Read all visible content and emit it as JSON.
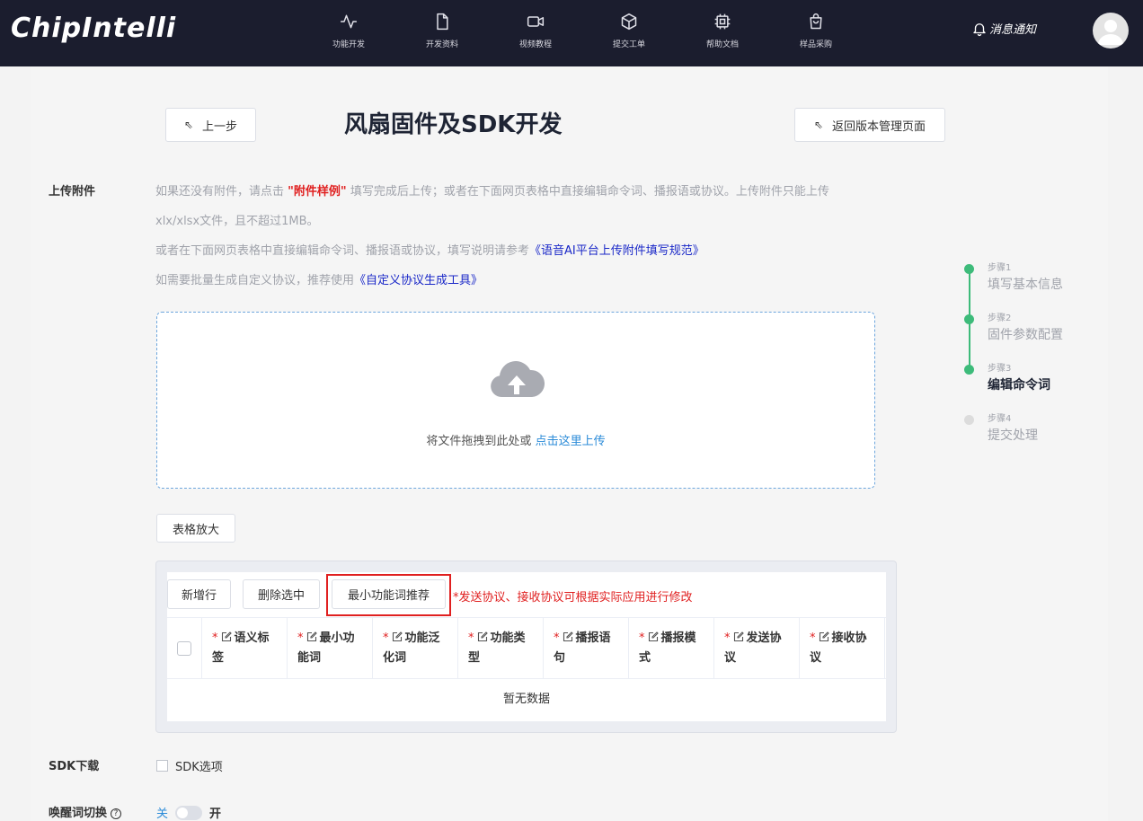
{
  "header": {
    "logo": "ChipIntelli",
    "nav": [
      {
        "label": "功能开发",
        "icon": "activity-icon"
      },
      {
        "label": "开发资料",
        "icon": "file-icon"
      },
      {
        "label": "视频教程",
        "icon": "video-icon"
      },
      {
        "label": "提交工单",
        "icon": "box-icon"
      },
      {
        "label": "帮助文档",
        "icon": "chip-icon"
      },
      {
        "label": "样品采购",
        "icon": "shopping-bag-icon"
      }
    ],
    "notify_label": "消息通知"
  },
  "toolbar": {
    "prev_label": "上一步",
    "back_label": "返回版本管理页面",
    "title": "风扇固件及SDK开发"
  },
  "upload_section": {
    "label": "上传附件",
    "line1_a": "如果还没有附件，请点击",
    "line1_link": "\"附件样例\"",
    "line1_b": "填写完成后上传；或者在下面网页表格中直接编辑命令词、播报语或协议。上传附件只能上传",
    "line2": "xlx/xlsx文件，且不超过1MB。",
    "line3_a": "或者在下面网页表格中直接编辑命令词、播报语或协议，填写说明请参考",
    "line3_link": "《语音AI平台上传附件填写规范》",
    "line4_a": "如需要批量生成自定义协议，推荐使用",
    "line4_link": "《自定义协议生成工具》",
    "drop_text": "将文件拖拽到此处或",
    "drop_link": "点击这里上传"
  },
  "table": {
    "enlarge_label": "表格放大",
    "add_label": "新增行",
    "delete_label": "删除选中",
    "recommend_label": "最小功能词推荐",
    "warning": "*发送协议、接收协议可根据实际应用进行修改",
    "columns": [
      {
        "l1": "语义标",
        "l2": "签"
      },
      {
        "l1": "最小功",
        "l2": "能词"
      },
      {
        "l1": "功能泛",
        "l2": "化词"
      },
      {
        "l1": "功能类",
        "l2": "型"
      },
      {
        "l1": "播报语",
        "l2": "句"
      },
      {
        "l1": "播报模",
        "l2": "式"
      },
      {
        "l1": "发送协",
        "l2": "议"
      },
      {
        "l1": "接收协",
        "l2": "议"
      }
    ],
    "empty_text": "暂无数据"
  },
  "sdk": {
    "label": "SDK下载",
    "option": "SDK选项"
  },
  "wake": {
    "label": "唤醒词切换",
    "off": "关",
    "on": "开",
    "enabled": false
  },
  "steps": [
    {
      "num": "步骤1",
      "name": "填写基本信息",
      "state": "done"
    },
    {
      "num": "步骤2",
      "name": "固件参数配置",
      "state": "done"
    },
    {
      "num": "步骤3",
      "name": "编辑命令词",
      "state": "active"
    },
    {
      "num": "步骤4",
      "name": "提交处理",
      "state": "todo"
    }
  ],
  "colors": {
    "header_bg": "#1b1d2e",
    "accent_green": "#3dbb7a",
    "link_blue": "#2b8bd8",
    "warning_red": "#e02020"
  }
}
